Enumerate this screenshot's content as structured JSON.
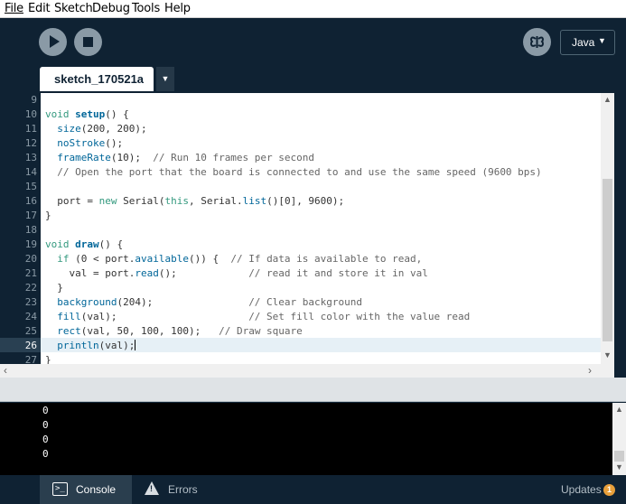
{
  "menu": {
    "items": [
      "File",
      "Edit",
      "Sketch",
      "Debug",
      "Tools",
      "Help"
    ]
  },
  "toolbar": {
    "run_icon": "play-icon",
    "stop_icon": "stop-icon",
    "debug_icon": "butterfly-icon",
    "mode": "Java",
    "mode_arrow": "▼"
  },
  "tabs": {
    "active": "sketch_170521a",
    "menu_arrow": "▼"
  },
  "editor": {
    "line_numbers": [
      "9",
      "10",
      "11",
      "12",
      "13",
      "14",
      "15",
      "16",
      "17",
      "18",
      "19",
      "20",
      "21",
      "22",
      "23",
      "24",
      "25",
      "26",
      "27"
    ],
    "current_line": "26",
    "lines": [
      "",
      "void setup() {",
      "  size(200, 200);",
      "  noStroke();",
      "  frameRate(10);  // Run 10 frames per second",
      "  // Open the port that the board is connected to and use the same speed (9600 bps)",
      "",
      "  port = new Serial(this, Serial.list()[0], 9600);",
      "}",
      "",
      "void draw() {",
      "  if (0 < port.available()) {  // If data is available to read,",
      "    val = port.read();            // read it and store it in val",
      "  }",
      "  background(204);                // Clear background",
      "  fill(val);                      // Set fill color with the value read",
      "  rect(val, 50, 100, 100);   // Draw square",
      "  println(val);",
      "}"
    ]
  },
  "console": {
    "lines": [
      "0",
      "0",
      "0",
      "0"
    ]
  },
  "footer": {
    "console_label": "Console",
    "errors_label": "Errors",
    "updates_label": "Updates",
    "updates_count": "1"
  },
  "colors": {
    "chrome": "#0f2233",
    "keyword": "#33997e",
    "function": "#006699",
    "badge": "#e89f3a"
  }
}
